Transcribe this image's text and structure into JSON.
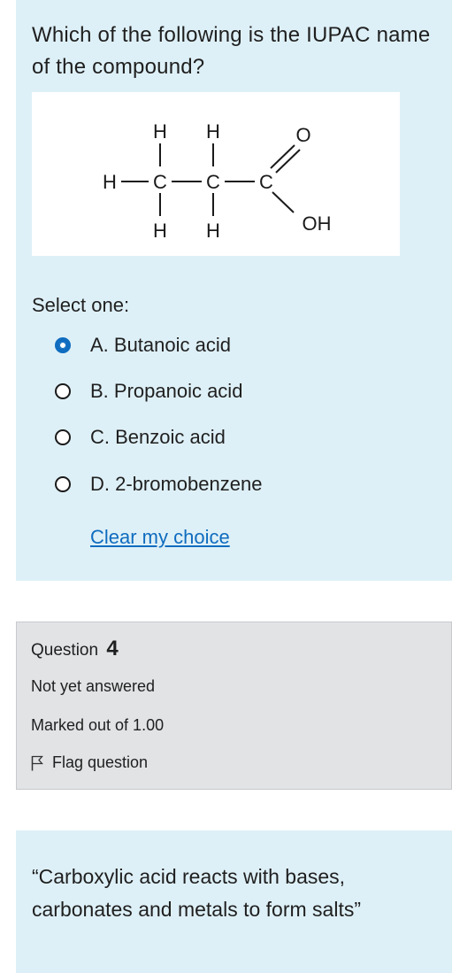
{
  "question": {
    "text": "Which of the following is the IUPAC name of the compound?",
    "structure_atoms": {
      "h": "H",
      "c": "C",
      "o": "O",
      "oh": "OH"
    },
    "select_label": "Select one:",
    "options": [
      {
        "label": "A. Butanoic acid",
        "selected": true
      },
      {
        "label": "B. Propanoic acid",
        "selected": false
      },
      {
        "label": "C. Benzoic acid",
        "selected": false
      },
      {
        "label": "D. 2-bromobenzene",
        "selected": false
      }
    ],
    "clear_label": "Clear my choice"
  },
  "info": {
    "question_word": "Question",
    "question_number": "4",
    "status": "Not yet answered",
    "marks": "Marked out of 1.00",
    "flag_label": "Flag question"
  },
  "description": {
    "text": "“Carboxylic acid reacts with bases, carbonates and metals to form salts”"
  },
  "colors": {
    "panel_bg": "#def0f7",
    "info_bg": "#e1e3e5",
    "accent": "#0f6cbf"
  }
}
